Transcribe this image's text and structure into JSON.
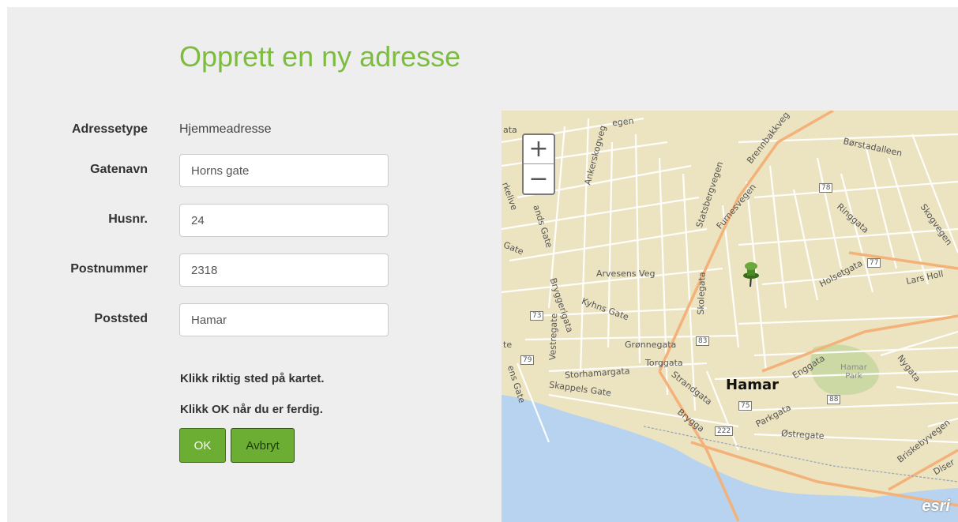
{
  "page": {
    "title": "Opprett en ny adresse"
  },
  "form": {
    "address_type": {
      "label": "Adressetype",
      "value": "Hjemmeadresse"
    },
    "street": {
      "label": "Gatenavn",
      "value": "Horns gate"
    },
    "house_number": {
      "label": "Husnr.",
      "value": "24"
    },
    "postal_code": {
      "label": "Postnummer",
      "value": "2318"
    },
    "city": {
      "label": "Poststed",
      "value": "Hamar"
    },
    "hint_map": "Klikk riktig sted på kartet.",
    "hint_ok": "Klikk OK når du er ferdig.",
    "ok_label": "OK",
    "cancel_label": "Avbryt"
  },
  "map": {
    "zoom_in": "+",
    "zoom_out": "−",
    "attribution": "esri",
    "marker_icon": "pushpin-icon",
    "labels": {
      "city": "Hamar",
      "park": "Hamar Park",
      "borstadalleen": "Børstadalleen",
      "brennbakkveg": "Brennbakkveg",
      "statsbergvegen": "Statsbergvegen",
      "furnesvegen": "Furnesvegen",
      "ringgata": "Ringgata",
      "skogvegen": "Skogvegen",
      "holsetgata": "Holsetgata",
      "lars_holl": "Lars Holl",
      "arvesens_veg": "Arvesens Veg",
      "skolegata": "Skolegata",
      "kyhns_gate": "Kyhns Gate",
      "bryggerigata": "Bryggerigata",
      "vestregate": "Vestregate",
      "gronnegata": "Grønnegata",
      "torggata": "Torggata",
      "storhamargata": "Storhamargata",
      "strandgata": "Strandgata",
      "skappels_gate": "Skappels Gate",
      "brygga": "Brygga",
      "parkgata": "Parkgata",
      "enggata": "Enggata",
      "ostregate": "Østregate",
      "nygata": "Nygata",
      "briskebyvegen": "Briskebyvegen",
      "ankerskogveg": "Ankerskogveg",
      "gate": "Gate",
      "hands_gate": "ands Gate",
      "egen": "egen",
      "ata": "ata",
      "ens_gate": "ens Gate",
      "diser": "Diser",
      "te": "te",
      "kelive": "rkelive",
      "shield_78": "78",
      "shield_77": "77",
      "shield_73": "73",
      "shield_83": "83",
      "shield_79": "79",
      "shield_75": "75",
      "shield_88": "88",
      "shield_222": "222"
    }
  }
}
